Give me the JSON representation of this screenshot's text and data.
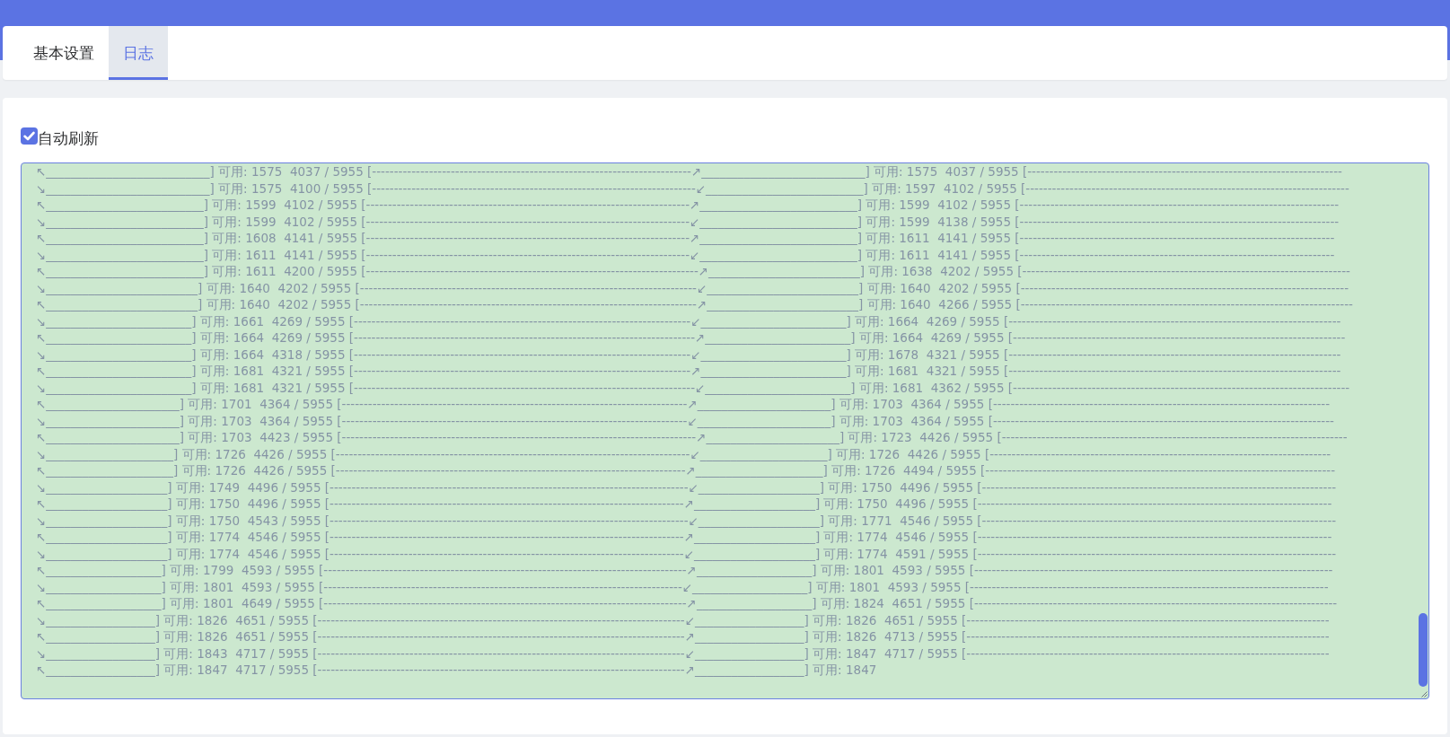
{
  "tabs": [
    {
      "label": "基本设置",
      "selected": false
    },
    {
      "label": "日志",
      "selected": true
    }
  ],
  "auto_refresh": {
    "label": "自动刷新",
    "checked": true
  },
  "log": {
    "lines": [
      "↖___________________________] 可用: 1575  4037 / 5955 [-------------------------------------------------------------------------↗___________________________] 可用: 1575  4037 / 5955 [------------------------------------------------------------------------",
      "↘___________________________] 可用: 1575  4100 / 5955 [--------------------------------------------------------------------------↙__________________________] 可用: 1597  4102 / 5955 [--------------------------------------------------------------------------",
      "↖__________________________] 可用: 1599  4102 / 5955 [--------------------------------------------------------------------------↗__________________________] 可用: 1599  4102 / 5955 [-------------------------------------------------------------------------",
      "↘__________________________] 可用: 1599  4102 / 5955 [--------------------------------------------------------------------------↙__________________________] 可用: 1599  4138 / 5955 [-------------------------------------------------------------------------",
      "↖__________________________] 可用: 1608  4141 / 5955 [--------------------------------------------------------------------------↗__________________________] 可用: 1611  4141 / 5955 [------------------------------------------------------------------------",
      "↘__________________________] 可用: 1611  4141 / 5955 [--------------------------------------------------------------------------↙__________________________] 可用: 1611  4141 / 5955 [------------------------------------------------------------------------",
      "↖__________________________] 可用: 1611  4200 / 5955 [----------------------------------------------------------------------------↗_________________________] 可用: 1638  4202 / 5955 [---------------------------------------------------------------------------",
      "↘_________________________] 可用: 1640  4202 / 5955 [-----------------------------------------------------------------------------↙_________________________] 可用: 1640  4202 / 5955 [---------------------------------------------------------------------------",
      "↖_________________________] 可用: 1640  4202 / 5955 [-----------------------------------------------------------------------------↗_________________________] 可用: 1640  4266 / 5955 [----------------------------------------------------------------------------",
      "↘________________________] 可用: 1661  4269 / 5955 [-----------------------------------------------------------------------------↙________________________] 可用: 1664  4269 / 5955 [----------------------------------------------------------------------------",
      "↖________________________] 可用: 1664  4269 / 5955 [------------------------------------------------------------------------------↗________________________] 可用: 1664  4269 / 5955 [----------------------------------------------------------------------------",
      "↘________________________] 可用: 1664  4318 / 5955 [-----------------------------------------------------------------------------↙________________________] 可用: 1678  4321 / 5955 [----------------------------------------------------------------------------",
      "↖________________________] 可用: 1681  4321 / 5955 [-----------------------------------------------------------------------------↗________________________] 可用: 1681  4321 / 5955 [----------------------------------------------------------------------------",
      "↘________________________] 可用: 1681  4321 / 5955 [------------------------------------------------------------------------------↙________________________] 可用: 1681  4362 / 5955 [-----------------------------------------------------------------------------",
      "↖______________________] 可用: 1701  4364 / 5955 [-------------------------------------------------------------------------------↗______________________] 可用: 1703  4364 / 5955 [-----------------------------------------------------------------------------",
      "↘______________________] 可用: 1703  4364 / 5955 [-------------------------------------------------------------------------------↙______________________] 可用: 1703  4364 / 5955 [------------------------------------------------------------------------------",
      "↖______________________] 可用: 1703  4423 / 5955 [---------------------------------------------------------------------------------↗______________________] 可用: 1723  4426 / 5955 [-------------------------------------------------------------------------------",
      "↘_____________________] 可用: 1726  4426 / 5955 [---------------------------------------------------------------------------------↙_____________________] 可用: 1726  4426 / 5955 [------------------------------------------------------------------------------",
      "↖_____________________] 可用: 1726  4426 / 5955 [--------------------------------------------------------------------------------↗_____________________] 可用: 1726  4494 / 5955 [--------------------------------------------------------------------------------",
      "↘____________________] 可用: 1749  4496 / 5955 [----------------------------------------------------------------------------------↙____________________] 可用: 1750  4496 / 5955 [---------------------------------------------------------------------------------",
      "↖____________________] 可用: 1750  4496 / 5955 [---------------------------------------------------------------------------------↗____________________] 可用: 1750  4496 / 5955 [---------------------------------------------------------------------------------",
      "↘____________________] 可用: 1750  4543 / 5955 [----------------------------------------------------------------------------------↙____________________] 可用: 1771  4546 / 5955 [---------------------------------------------------------------------------------",
      "↖____________________] 可用: 1774  4546 / 5955 [---------------------------------------------------------------------------------↗____________________] 可用: 1774  4546 / 5955 [---------------------------------------------------------------------------------",
      "↘____________________] 可用: 1774  4546 / 5955 [---------------------------------------------------------------------------------↙____________________] 可用: 1774  4591 / 5955 [----------------------------------------------------------------------------------",
      "↖___________________] 可用: 1799  4593 / 5955 [-----------------------------------------------------------------------------------↗___________________] 可用: 1801  4593 / 5955 [----------------------------------------------------------------------------------",
      "↘___________________] 可用: 1801  4593 / 5955 [----------------------------------------------------------------------------------↙___________________] 可用: 1801  4593 / 5955 [----------------------------------------------------------------------------------",
      "↖___________________] 可用: 1801  4649 / 5955 [-----------------------------------------------------------------------------------↗___________________] 可用: 1824  4651 / 5955 [-----------------------------------------------------------------------------------",
      "↘__________________] 可用: 1826  4651 / 5955 [------------------------------------------------------------------------------------↙__________________] 可用: 1826  4651 / 5955 [-----------------------------------------------------------------------------------",
      "↖__________________] 可用: 1826  4651 / 5955 [------------------------------------------------------------------------------------↗__________________] 可用: 1826  4713 / 5955 [-----------------------------------------------------------------------------------",
      "↘__________________] 可用: 1843  4717 / 5955 [------------------------------------------------------------------------------------↙__________________] 可用: 1847  4717 / 5955 [-----------------------------------------------------------------------------------",
      "↖__________________] 可用: 1847  4717 / 5955 [------------------------------------------------------------------------------------↗__________________] 可用: 1847"
    ]
  }
}
